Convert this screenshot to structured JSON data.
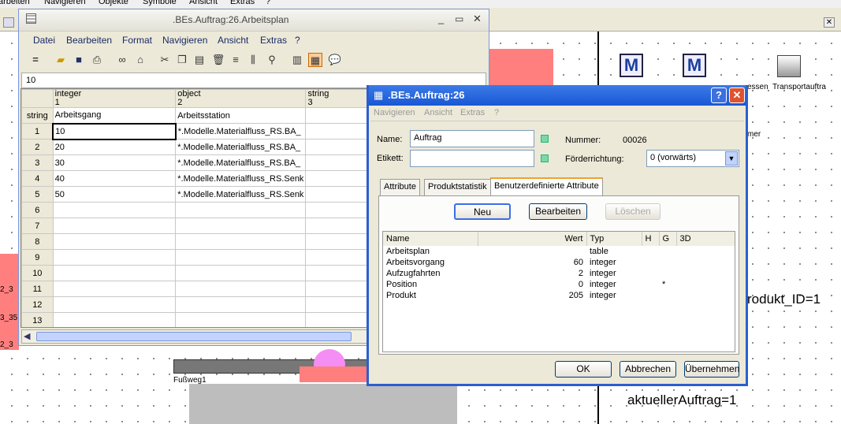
{
  "background": {
    "menu": [
      "arbeiten",
      "Navigieren",
      "Objekte",
      "Symbole",
      "Ansicht",
      "Extras",
      "?"
    ],
    "right_texts": [
      "essen",
      "Transportauftra",
      "mer",
      "rodukt_ID=1"
    ],
    "bottom_text": "aktuellerAuftrag=1",
    "left_fragments": [
      "2_3",
      "3_35",
      "2_3"
    ],
    "path_label": "Fußweg1"
  },
  "window1": {
    "title": ".BEs.Auftrag:26.Arbeitsplan",
    "menu": [
      "Datei",
      "Bearbeiten",
      "Format",
      "Navigieren",
      "Ansicht",
      "Extras",
      "?"
    ],
    "cell_value": "10",
    "col_types": [
      {
        "type": "integer",
        "num": "1"
      },
      {
        "type": "object",
        "num": "2"
      },
      {
        "type": "string",
        "num": "3"
      }
    ],
    "row_header_label": "string",
    "col_names": [
      "Arbeitsgang",
      "Arbeitsstation",
      ""
    ],
    "rows": [
      {
        "n": "1",
        "a": "10",
        "b": "*.Modelle.Materialfluss_RS.BA_"
      },
      {
        "n": "2",
        "a": "20",
        "b": "*.Modelle.Materialfluss_RS.BA_"
      },
      {
        "n": "3",
        "a": "30",
        "b": "*.Modelle.Materialfluss_RS.BA_"
      },
      {
        "n": "4",
        "a": "40",
        "b": "*.Modelle.Materialfluss_RS.Senk"
      },
      {
        "n": "5",
        "a": "50",
        "b": "*.Modelle.Materialfluss_RS.Senk"
      },
      {
        "n": "6",
        "a": "",
        "b": ""
      },
      {
        "n": "7",
        "a": "",
        "b": ""
      },
      {
        "n": "8",
        "a": "",
        "b": ""
      },
      {
        "n": "9",
        "a": "",
        "b": ""
      },
      {
        "n": "10",
        "a": "",
        "b": ""
      },
      {
        "n": "11",
        "a": "",
        "b": ""
      },
      {
        "n": "12",
        "a": "",
        "b": ""
      },
      {
        "n": "13",
        "a": "",
        "b": ""
      }
    ]
  },
  "dialog": {
    "title": ".BEs.Auftrag:26",
    "help": "?",
    "menu": [
      "Navigieren",
      "Ansicht",
      "Extras",
      "?"
    ],
    "name_label": "Name:",
    "name_value": "Auftrag",
    "label_label": "Etikett:",
    "label_value": "",
    "number_label": "Nummer:",
    "number_value": "00026",
    "direction_label": "Förderrichtung:",
    "direction_value": "0 (vorwärts)",
    "tabs": [
      "Attribute",
      "Produktstatistik",
      "Benutzerdefinierte Attribute"
    ],
    "buttons": {
      "new": "Neu",
      "edit": "Bearbeiten",
      "delete": "Löschen",
      "ok": "OK",
      "cancel": "Abbrechen",
      "apply": "Übernehmen"
    },
    "columns": [
      "Name",
      "Wert",
      "Typ",
      "H",
      "G",
      "3D"
    ],
    "attributes": [
      {
        "name": "Arbeitsplan",
        "value": "",
        "type": "table",
        "h": "",
        "g": ""
      },
      {
        "name": "Arbeitsvorgang",
        "value": "60",
        "type": "integer",
        "h": "",
        "g": ""
      },
      {
        "name": "Aufzugfahrten",
        "value": "2",
        "type": "integer",
        "h": "",
        "g": ""
      },
      {
        "name": "Position",
        "value": "0",
        "type": "integer",
        "h": "",
        "g": "*"
      },
      {
        "name": "Produkt",
        "value": "205",
        "type": "integer",
        "h": "",
        "g": ""
      }
    ]
  },
  "colors": {
    "accent": "#2b5fcf",
    "pink": "#ff7f7f",
    "magenta_dot": "#f48ef4"
  }
}
